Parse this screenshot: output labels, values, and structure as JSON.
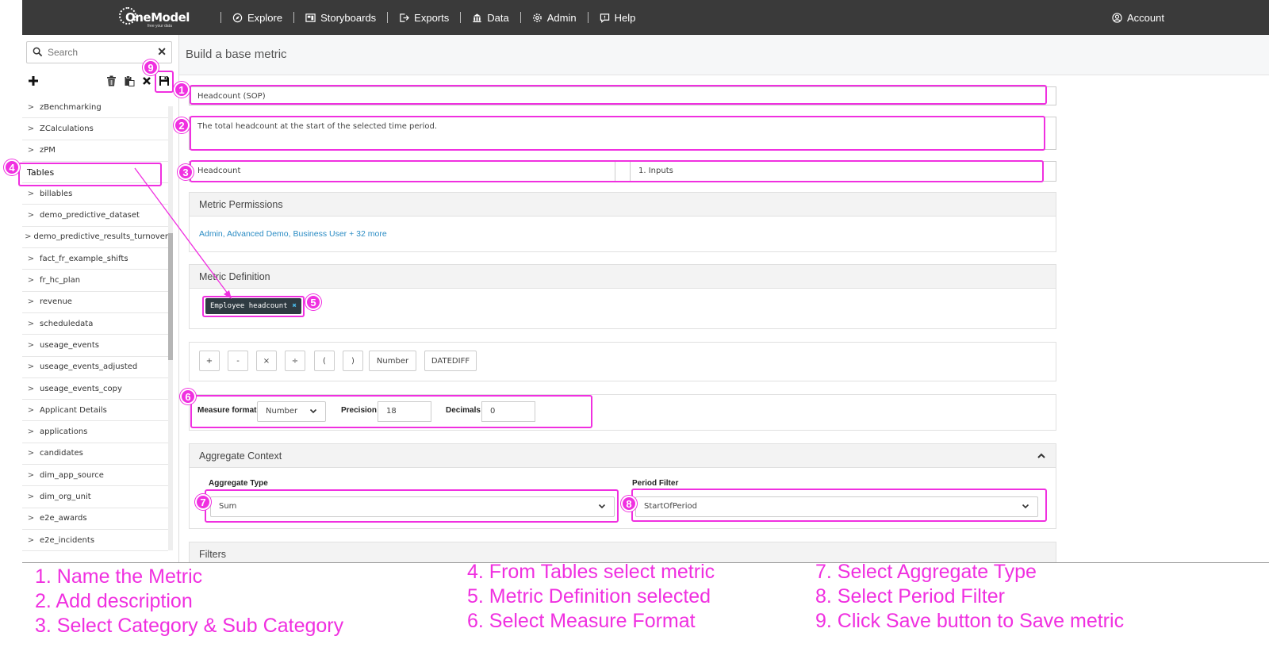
{
  "app": {
    "logo_text": "OneModel",
    "logo_tagline": "free your data"
  },
  "nav": {
    "items": [
      {
        "label": "Explore",
        "icon": "compass-icon"
      },
      {
        "label": "Storyboards",
        "icon": "storyboard-icon"
      },
      {
        "label": "Exports",
        "icon": "export-icon"
      },
      {
        "label": "Data",
        "icon": "data-icon"
      },
      {
        "label": "Admin",
        "icon": "gear-icon"
      },
      {
        "label": "Help",
        "icon": "help-icon"
      }
    ],
    "account": "Account"
  },
  "sidebar": {
    "search_placeholder": "Search",
    "tree_top": [
      "zBenchmarking",
      "ZCalculations",
      "zPM"
    ],
    "section_label": "Tables",
    "tables": [
      "billables",
      "demo_predictive_dataset",
      "demo_predictive_results_turnover",
      "fact_fr_example_shifts",
      "fr_hc_plan",
      "revenue",
      "scheduledata",
      "useage_events",
      "useage_events_adjusted",
      "useage_events_copy",
      "Applicant Details",
      "applications",
      "candidates",
      "dim_app_source",
      "dim_org_unit",
      "e2e_awards",
      "e2e_incidents"
    ]
  },
  "page": {
    "title": "Build a base metric"
  },
  "form": {
    "name": "Headcount (SOP)",
    "description": "The total headcount at the start of the selected time period.",
    "category": "Headcount",
    "sub_category": "1. Inputs"
  },
  "permissions": {
    "title": "Metric Permissions",
    "roles": "Admin, Advanced Demo, Business User + 32 more"
  },
  "definition": {
    "title": "Metric Definition",
    "chip": "Employee headcount"
  },
  "operators": [
    "+",
    "-",
    "×",
    "÷",
    "(",
    ")",
    "Number",
    "DATEDIFF"
  ],
  "measure": {
    "format_label": "Measure format",
    "format_value": "Number",
    "precision_label": "Precision",
    "precision_value": "18",
    "decimals_label": "Decimals",
    "decimals_value": "0"
  },
  "aggregate": {
    "title": "Aggregate Context",
    "type_label": "Aggregate Type",
    "type_value": "Sum",
    "period_label": "Period Filter",
    "period_value": "StartOfPeriod"
  },
  "filters": {
    "title": "Filters"
  },
  "annotations": {
    "accent": "#f030e0",
    "badges": [
      "1",
      "2",
      "3",
      "4",
      "5",
      "6",
      "7",
      "8",
      "9"
    ],
    "steps": [
      "1. Name the Metric",
      "2. Add description",
      "3. Select Category & Sub Category",
      "4. From Tables select metric",
      "5. Metric Definition selected",
      "6. Select Measure Format",
      "7. Select Aggregate Type",
      "8. Select Period Filter",
      "9. Click Save button to Save metric"
    ]
  }
}
